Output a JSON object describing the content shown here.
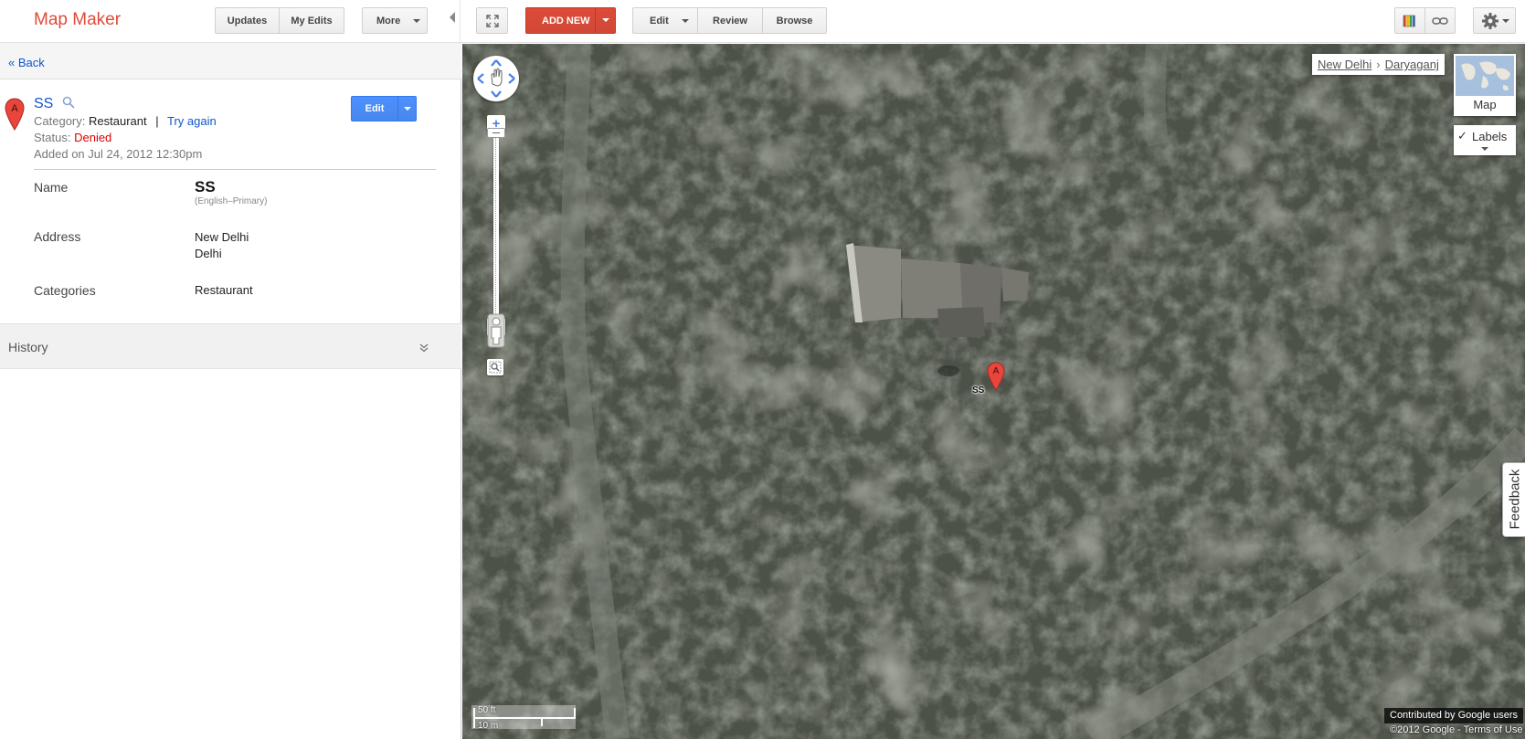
{
  "app": {
    "title": "Map Maker"
  },
  "toolbar": {
    "updates": "Updates",
    "my_edits": "My Edits",
    "more": "More",
    "add_new": "ADD NEW",
    "edit": "Edit",
    "review": "Review",
    "browse": "Browse"
  },
  "panel": {
    "back": "« Back",
    "marker_letter": "A",
    "place_title": "SS",
    "category_label": "Category:",
    "category_value": "Restaurant",
    "category_sep": "|",
    "try_again": "Try again",
    "status_label": "Status:",
    "status_value": "Denied",
    "added_on": "Added on Jul 24, 2012 12:30pm",
    "edit_button": "Edit",
    "rows": {
      "name_label": "Name",
      "name_value": "SS",
      "name_sub": "(English–Primary)",
      "address_label": "Address",
      "address_line1": "New Delhi",
      "address_line2": "Delhi",
      "categories_label": "Categories",
      "categories_value": "Restaurant"
    },
    "history_label": "History"
  },
  "map": {
    "breadcrumb_city": "New Delhi",
    "breadcrumb_sep": "›",
    "breadcrumb_area": "Daryaganj",
    "map_type_label": "Map",
    "labels_toggle": "Labels",
    "labels_checked": true,
    "marker_letter": "A",
    "marker_label": "SS",
    "scale_ft": "50 ft",
    "scale_m": "10 m",
    "contributed": "Contributed by Google users",
    "copyright": "©2012 Google - Terms of Use",
    "feedback": "Feedback"
  },
  "colors": {
    "accent_red": "#dd4b39",
    "link_blue": "#1155cc",
    "edit_blue": "#4d90fe",
    "denied_red": "#dd0000"
  }
}
